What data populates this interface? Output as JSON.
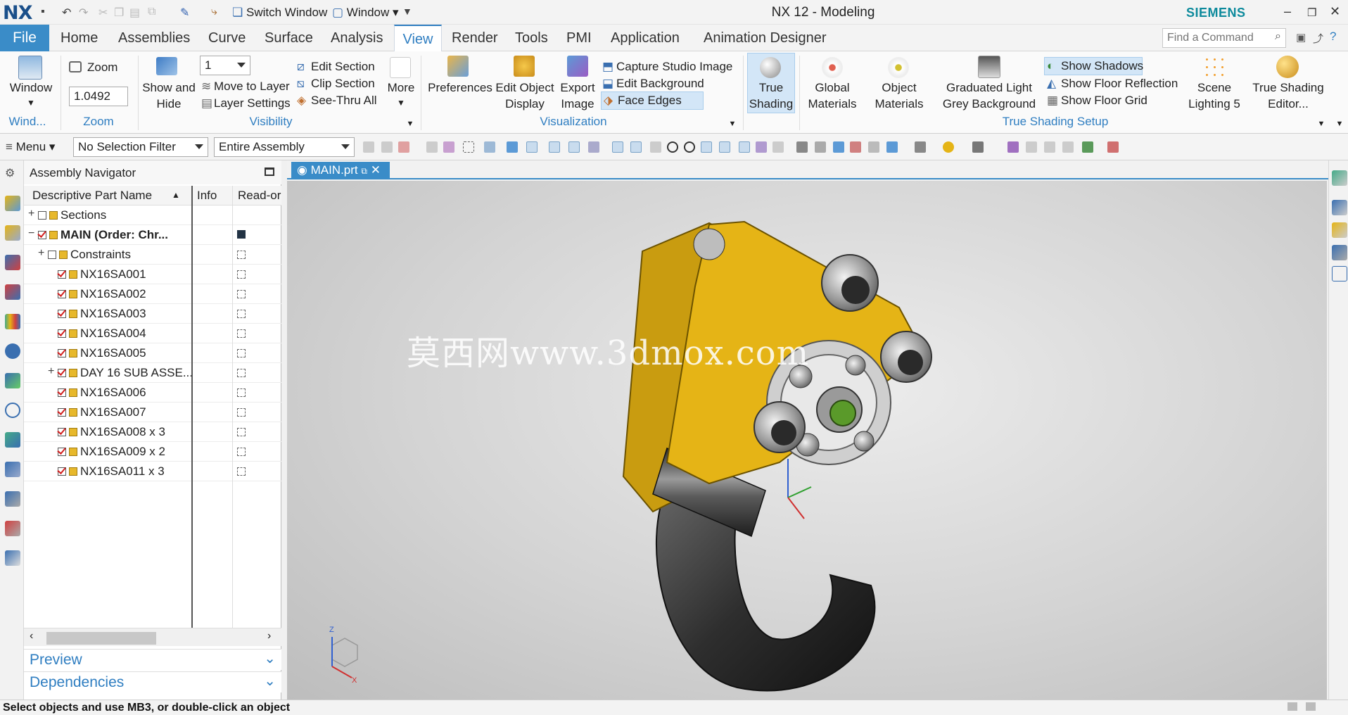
{
  "app": {
    "logo": "NX",
    "title": "NX 12 - Modeling",
    "brand": "SIEMENS"
  },
  "quick_access": {
    "switch_window": "Switch Window",
    "window": "Window"
  },
  "menu_tabs": [
    "File",
    "Home",
    "Assemblies",
    "Curve",
    "Surface",
    "Analysis",
    "View",
    "Render",
    "Tools",
    "PMI",
    "Application",
    "Animation Designer"
  ],
  "active_tab": "View",
  "find_command": {
    "placeholder": "Find a Command"
  },
  "ribbon": {
    "window": {
      "label": "Window",
      "group": "Wind..."
    },
    "zoom": {
      "label": "Zoom",
      "value": "1.0492",
      "group": "Zoom"
    },
    "visibility": {
      "show_hide": "Show and Hide",
      "layer_value": "1",
      "move_to_layer": "Move to Layer",
      "layer_settings": "Layer Settings",
      "edit_section": "Edit Section",
      "clip_section": "Clip Section",
      "see_thru_all": "See-Thru All",
      "more": "More",
      "group": "Visibility"
    },
    "visualization": {
      "preferences": "Preferences",
      "edit_object_display": "Edit Object Display",
      "export_image": "Export Image",
      "capture_studio_image": "Capture Studio Image",
      "edit_background": "Edit Background",
      "face_edges": "Face Edges",
      "group": "Visualization"
    },
    "true_shading": {
      "true_shading": "True Shading",
      "global_materials": "Global Materials",
      "object_materials": "Object Materials",
      "graduated_light": "Graduated Light Grey Background",
      "show_shadows": "Show Shadows",
      "show_floor_reflection": "Show Floor Reflection",
      "show_floor_grid": "Show Floor Grid",
      "scene_lighting": "Scene Lighting 5",
      "true_shading_editor": "True Shading Editor...",
      "group": "True Shading Setup"
    }
  },
  "toolbar": {
    "menu": "Menu",
    "selection_filter": "No Selection Filter",
    "scope": "Entire Assembly"
  },
  "navigator": {
    "title": "Assembly Navigator",
    "columns": [
      "Descriptive Part Name",
      "Info",
      "Read-or"
    ],
    "rows": [
      {
        "name": "Sections",
        "indent": 0,
        "expand": "+",
        "checked": false,
        "bold": false
      },
      {
        "name": "MAIN (Order: Chr...",
        "indent": 0,
        "expand": "−",
        "checked": true,
        "bold": true
      },
      {
        "name": "Constraints",
        "indent": 1,
        "expand": "+",
        "checked": false,
        "bold": false
      },
      {
        "name": "NX16SA001",
        "indent": 2,
        "expand": "",
        "checked": true,
        "bold": false
      },
      {
        "name": "NX16SA002",
        "indent": 2,
        "expand": "",
        "checked": true,
        "bold": false
      },
      {
        "name": "NX16SA003",
        "indent": 2,
        "expand": "",
        "checked": true,
        "bold": false
      },
      {
        "name": "NX16SA004",
        "indent": 2,
        "expand": "",
        "checked": true,
        "bold": false
      },
      {
        "name": "NX16SA005",
        "indent": 2,
        "expand": "",
        "checked": true,
        "bold": false
      },
      {
        "name": "DAY 16 SUB ASSE...",
        "indent": 2,
        "expand": "+",
        "checked": true,
        "bold": false
      },
      {
        "name": "NX16SA006",
        "indent": 2,
        "expand": "",
        "checked": true,
        "bold": false
      },
      {
        "name": "NX16SA007",
        "indent": 2,
        "expand": "",
        "checked": true,
        "bold": false
      },
      {
        "name": "NX16SA008 x 3",
        "indent": 2,
        "expand": "",
        "checked": true,
        "bold": false
      },
      {
        "name": "NX16SA009 x 2",
        "indent": 2,
        "expand": "",
        "checked": true,
        "bold": false
      },
      {
        "name": "NX16SA011 x 3",
        "indent": 2,
        "expand": "",
        "checked": true,
        "bold": false
      }
    ],
    "preview": "Preview",
    "dependencies": "Dependencies"
  },
  "document_tab": "MAIN.prt",
  "watermark": "莫西网www.3dmox.com",
  "triad": {
    "z": "Z",
    "x": "X"
  },
  "status": "Select objects and use MB3, or double-click an object",
  "colors": {
    "accent": "#2f7ec1",
    "file_tab": "#3a8cc8",
    "plate": "#e5b416",
    "brand": "#0d8a9c"
  }
}
